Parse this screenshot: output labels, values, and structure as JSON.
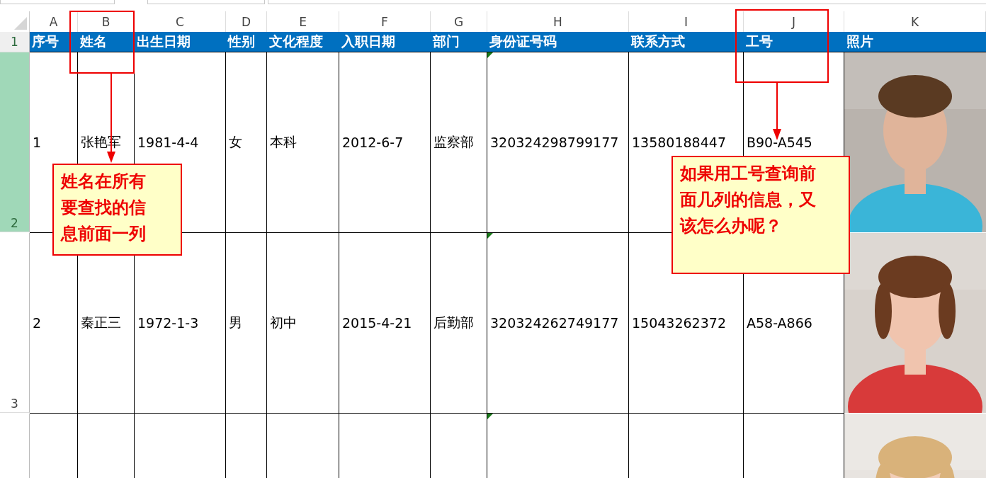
{
  "columns": [
    {
      "letter": "A",
      "header": "序号"
    },
    {
      "letter": "B",
      "header": "姓名"
    },
    {
      "letter": "C",
      "header": "出生日期"
    },
    {
      "letter": "D",
      "header": "性别"
    },
    {
      "letter": "E",
      "header": "文化程度"
    },
    {
      "letter": "F",
      "header": "入职日期"
    },
    {
      "letter": "G",
      "header": "部门"
    },
    {
      "letter": "H",
      "header": "身份证号码"
    },
    {
      "letter": "I",
      "header": "联系方式"
    },
    {
      "letter": "J",
      "header": "工号"
    },
    {
      "letter": "K",
      "header": "照片"
    }
  ],
  "header_row_number": "1",
  "rows": [
    {
      "number": "2",
      "selected": true,
      "cells": [
        "1",
        "张艳军",
        "1981-4-4",
        "女",
        "本科",
        "2012-6-7",
        "监察部",
        "320324298799177",
        "13580188447",
        "B90-A545"
      ],
      "photo": {
        "kind": "picture"
      }
    },
    {
      "number": "3",
      "selected": false,
      "cells": [
        "2",
        "秦正三",
        "1972-1-3",
        "男",
        "初中",
        "2015-4-21",
        "后勤部",
        "320324262749177",
        "15043262372",
        "A58-A866"
      ],
      "photo": {
        "kind": "picture"
      }
    },
    {
      "photo": {
        "kind": "picture"
      }
    }
  ],
  "annotations": [
    {
      "kind": "left",
      "text": "姓名在所有要查找的信息前面一列"
    },
    {
      "kind": "right",
      "text": "如果用工号查询前面几列的信息，又该怎么办呢？"
    }
  ]
}
